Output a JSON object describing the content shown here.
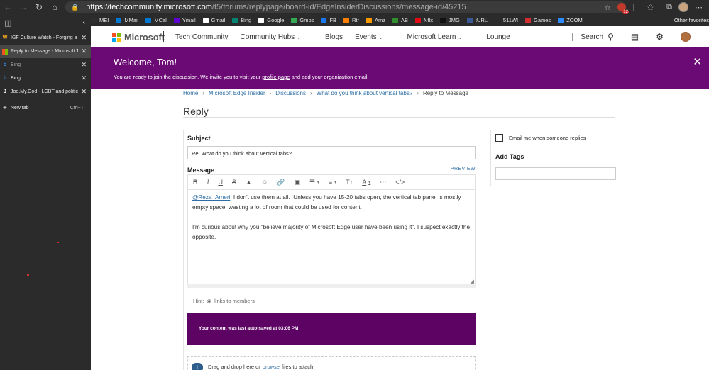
{
  "browser": {
    "url_host": "https://techcommunity.microsoft.com",
    "url_path": "/t5/forums/replypage/board-id/EdgeInsiderDiscussions/message-id/45215",
    "notification_count": "12",
    "bookmarks": [
      {
        "label": "MEI",
        "color": "#2f2f2f"
      },
      {
        "label": "MMail",
        "color": "#0078d4"
      },
      {
        "label": "MCal",
        "color": "#0078d4"
      },
      {
        "label": "Ymail",
        "color": "#6001d2"
      },
      {
        "label": "Gmail",
        "color": "#ffffff"
      },
      {
        "label": "Bing",
        "color": "#008373"
      },
      {
        "label": "Google",
        "color": "#ffffff"
      },
      {
        "label": "Gmps",
        "color": "#34a853"
      },
      {
        "label": "FB",
        "color": "#1877f2"
      },
      {
        "label": "Rtr",
        "color": "#ff8000"
      },
      {
        "label": "Amz",
        "color": "#ff9900"
      },
      {
        "label": "AB",
        "color": "#2f8f2f"
      },
      {
        "label": "Nflx",
        "color": "#e50914"
      },
      {
        "label": "JMG",
        "color": "#111111"
      },
      {
        "label": "tURL",
        "color": "#3b5998"
      },
      {
        "label": "511WI",
        "color": "#2b2b2b"
      },
      {
        "label": "Games",
        "color": "#d32f2f"
      },
      {
        "label": "ZOOM",
        "color": "#2d8cff"
      }
    ],
    "other_favorites": "Other favorites"
  },
  "tabs": [
    {
      "icon": "W",
      "icon_color": "#f5a623",
      "title": "IGF Culture Watch - Forging a Cu",
      "active": false,
      "dim": false
    },
    {
      "icon": "",
      "icon_color": "#6c0a75",
      "title": "Reply to Message - Microsoft Tec",
      "active": true,
      "dim": false
    },
    {
      "icon": "b",
      "icon_color": "#3a8ee6",
      "title": "Bing",
      "active": false,
      "dim": true
    },
    {
      "icon": "b",
      "icon_color": "#3a8ee6",
      "title": "Bing",
      "active": false,
      "dim": false
    },
    {
      "icon": "J",
      "icon_color": "#ffffff",
      "title": "Joe.My.God - LGBT and political n",
      "active": false,
      "dim": false
    }
  ],
  "new_tab": {
    "label": "New tab",
    "shortcut": "Ctrl+T"
  },
  "site": {
    "brand": "Microsoft",
    "section": "Tech Community",
    "nav": [
      {
        "label": "Community Hubs",
        "has_menu": true
      },
      {
        "label": "Blogs",
        "has_menu": false
      },
      {
        "label": "Events",
        "has_menu": true
      },
      {
        "label": "Microsoft Learn",
        "has_menu": true
      },
      {
        "label": "Lounge",
        "has_menu": false
      }
    ],
    "search_label": "Search"
  },
  "banner": {
    "title": "Welcome, Tom!",
    "text_before": "You are ready to join the discussion. We invite you to visit your ",
    "link": "profile page",
    "text_after": " and add your organization email."
  },
  "breadcrumb": [
    "Home",
    "Microsoft Edge Insider",
    "Discussions",
    "What do you think about vertical tabs?",
    "Reply to Message"
  ],
  "page_title": "Reply",
  "form": {
    "subject_label": "Subject",
    "subject_value": "Re: What do you think about vertical tabs?",
    "message_label": "Message",
    "preview_label": "PREVIEW",
    "mention": "@Reza_Ameri",
    "para1": "  I don't use them at all.  Unless you have 15-20 tabs open, the vertical tab panel is mostly empty space, wasting a lot of room that could be used for content.",
    "para2": "I'm curious about why you \"believe majority of Microsoft Edge user have been using it\".  I suspect exactly the opposite.",
    "hint_label": "Hint:",
    "hint_text": "links to members",
    "autosave_text": "Your content was last auto-saved at 03:06 PM",
    "attach_before": "Drag and drop here or",
    "attach_link": "browse",
    "attach_after": "files to attach"
  },
  "sidebar": {
    "email_label": "Email me when someone replies",
    "tags_label": "Add Tags"
  }
}
